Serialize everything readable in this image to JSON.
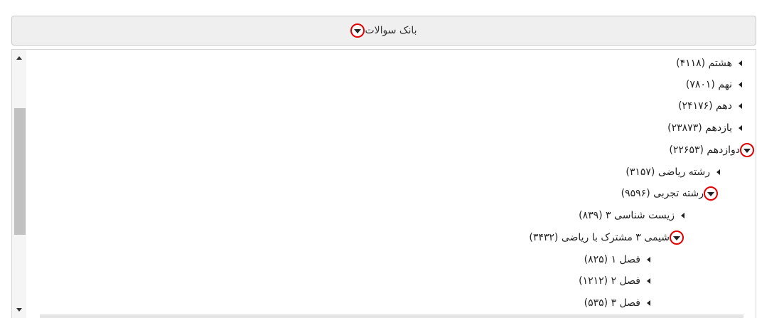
{
  "header": {
    "title": "بانک سوالات"
  },
  "tree": [
    {
      "label": "هشتم (۴۱۱۸)",
      "state": "collapsed"
    },
    {
      "label": "نهم (۷۸۰۱)",
      "state": "collapsed"
    },
    {
      "label": "دهم (۲۴۱۷۶)",
      "state": "collapsed"
    },
    {
      "label": "یازدهم (۲۳۸۷۳)",
      "state": "collapsed"
    },
    {
      "label": "دوازدهم (۲۲۶۵۳)",
      "state": "expanded"
    },
    {
      "label": "رشته ریاضی (۳۱۵۷)",
      "state": "collapsed"
    },
    {
      "label": "رشته تجربی (۹۵۹۶)",
      "state": "expanded"
    },
    {
      "label": "زیست شناسی ۳ (۸۳۹)",
      "state": "collapsed"
    },
    {
      "label": "شیمی ۳ مشترک با ریاضی (۳۴۳۲)",
      "state": "expanded"
    },
    {
      "label": "فصل ۱ (۸۲۵)",
      "state": "collapsed"
    },
    {
      "label": "فصل ۲ (۱۲۱۲)",
      "state": "collapsed"
    },
    {
      "label": "فصل ۳ (۵۳۵)",
      "state": "collapsed"
    }
  ],
  "icons": {
    "expanded": "circled-caret-down-icon",
    "collapsed": "caret-left-icon"
  },
  "colors": {
    "toggle_ring": "#e00000",
    "header_bg": "#efefef"
  }
}
